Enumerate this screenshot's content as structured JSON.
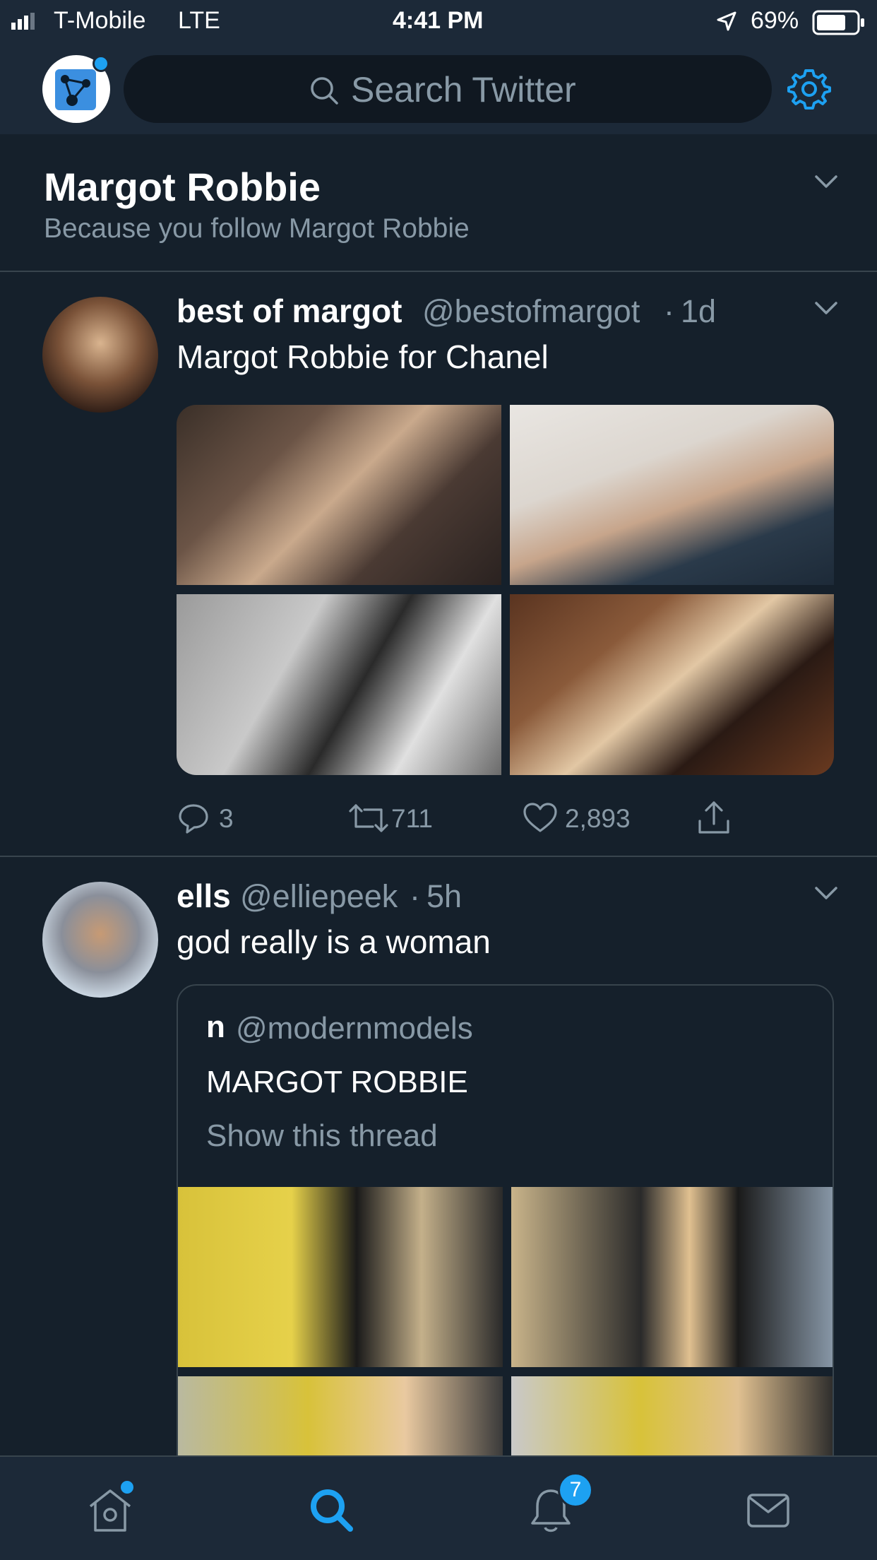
{
  "status_bar": {
    "carrier": "T-Mobile",
    "network": "LTE",
    "time": "4:41 PM",
    "battery": "69%"
  },
  "header": {
    "search_placeholder": "Search Twitter"
  },
  "topic": {
    "title": "Margot Robbie",
    "subtitle": "Because you follow Margot Robbie"
  },
  "tweets": [
    {
      "name": "best of margot",
      "handle": "@bestofmargot",
      "separator": "·",
      "time": "1d",
      "text": "Margot Robbie for Chanel",
      "replies": "3",
      "retweets": "711",
      "likes": "2,893"
    },
    {
      "name": "ells",
      "handle": "@elliepeek",
      "separator": "·",
      "time": "5h",
      "text": "god really is a woman",
      "quote": {
        "name": "n",
        "handle": "@modernmodels",
        "text": "MARGOT ROBBIE",
        "show_thread": "Show this thread"
      }
    }
  ],
  "tab_bar": {
    "notifications_badge": "7"
  },
  "colors": {
    "background": "#15202b",
    "bar_background": "#1c2938",
    "accent": "#1da1f2",
    "muted_text": "#8899a6",
    "divider": "#38444d"
  }
}
